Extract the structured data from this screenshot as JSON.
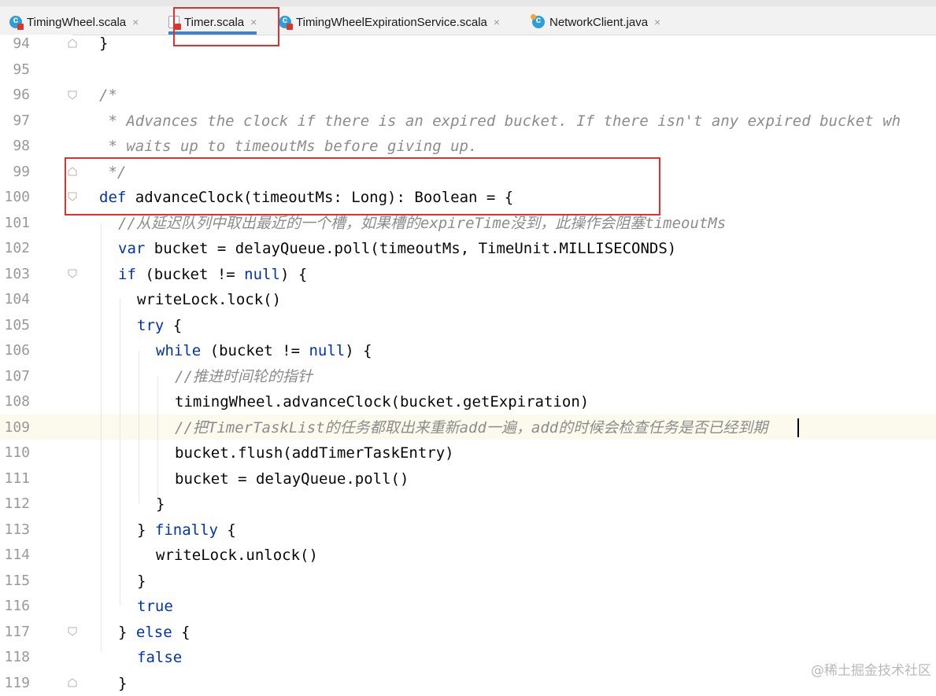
{
  "tabs": [
    {
      "label": "TimingWheel.scala",
      "icon": "scala-class-icon",
      "active": false
    },
    {
      "label": "Timer.scala",
      "icon": "scala-file-icon",
      "active": true
    },
    {
      "label": "TimingWheelExpirationService.scala",
      "icon": "scala-class-icon",
      "active": false
    },
    {
      "label": "NetworkClient.java",
      "icon": "java-class-icon",
      "active": false
    }
  ],
  "close_glyph": "×",
  "editor": {
    "line_numbers": [
      "94",
      "95",
      "96",
      "97",
      "98",
      "99",
      "100",
      "101",
      "102",
      "103",
      "104",
      "105",
      "106",
      "107",
      "108",
      "109",
      "110",
      "111",
      "112",
      "113",
      "114",
      "115",
      "116",
      "117",
      "118",
      "119"
    ],
    "current_line": "109",
    "code": {
      "l94": "}",
      "l96": "/*",
      "l97": " * Advances the clock if there is an expired bucket. If there isn't any expired bucket wh",
      "l98": " * waits up to timeoutMs before giving up.",
      "l99": " */",
      "l100_kw": "def",
      "l100_rest": " advanceClock(timeoutMs: Long): Boolean = {",
      "l101": "//从延迟队列中取出最近的一个槽，如果槽的expireTime没到，此操作会阻塞timeoutMs",
      "l102_kw": "var",
      "l102_rest": " bucket = delayQueue.poll(timeoutMs, TimeUnit.MILLISECONDS)",
      "l103_kw": "if",
      "l103_a": " (bucket != ",
      "l103_null": "null",
      "l103_b": ") {",
      "l104": "writeLock.lock()",
      "l105_kw": "try",
      "l105_rest": " {",
      "l106_kw": "while",
      "l106_a": " (bucket != ",
      "l106_null": "null",
      "l106_b": ") {",
      "l107": "//推进时间轮的指针",
      "l108": "timingWheel.advanceClock(bucket.getExpiration)",
      "l109": "//把TimerTaskList的任务都取出来重新add一遍，add的时候会检查任务是否已经到期",
      "l110": "bucket.flush(addTimerTaskEntry)",
      "l111": "bucket = delayQueue.poll()",
      "l112": "}",
      "l113_a": "} ",
      "l113_kw": "finally",
      "l113_b": " {",
      "l114": "writeLock.unlock()",
      "l115": "}",
      "l116_kw": "true",
      "l117_a": "} ",
      "l117_kw": "else",
      "l117_b": " {",
      "l118_kw": "false",
      "l119": "}"
    }
  },
  "watermark": "@稀土掘金技术社区",
  "colors": {
    "keyword": "#0033b3",
    "comment": "#8c8c8c",
    "highlight_box": "#e03131",
    "active_tab_underline": "#4083c9"
  }
}
